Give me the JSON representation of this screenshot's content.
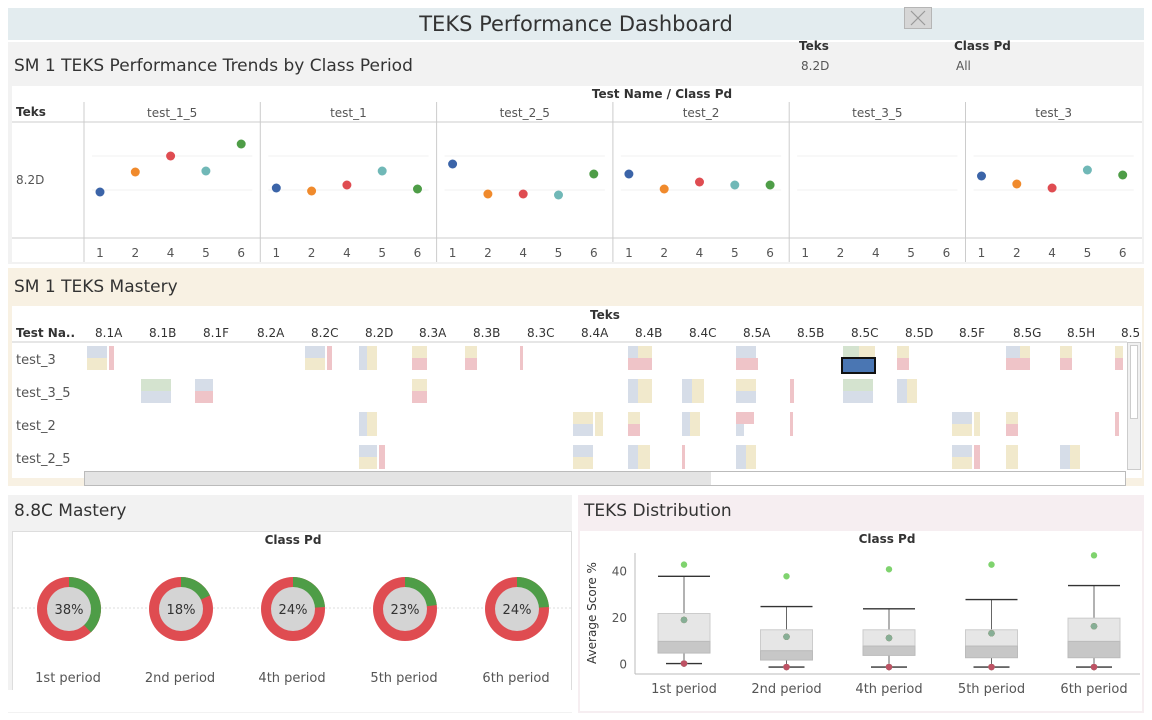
{
  "dashboard_title": "TEKS Performance Dashboard",
  "trend": {
    "title": "SM 1 TEKS Performance Trends by Class Period",
    "filter_teks_label": "Teks",
    "filter_teks_value": "8.2D",
    "filter_classpd_label": "Class Pd",
    "filter_classpd_value": "All",
    "header_label": "Test Name / Class Pd",
    "row_header": "Teks",
    "row_value": "8.2D",
    "panels": [
      "test_1_5",
      "test_1",
      "test_2_5",
      "test_2",
      "test_3_5",
      "test_3"
    ],
    "periods": [
      "1",
      "2",
      "4",
      "5",
      "6"
    ],
    "colors": {
      "1": "#3b64a8",
      "2": "#f08a2c",
      "4": "#df4c51",
      "5": "#70b8b7",
      "6": "#4e9d47"
    },
    "chart_data": {
      "type": "scatter",
      "note_series": "one point per class period within each test panel",
      "panels": [
        {
          "name": "test_1_5",
          "values": [
            0.38,
            0.58,
            0.74,
            0.59,
            0.86
          ]
        },
        {
          "name": "test_1",
          "values": [
            0.42,
            0.39,
            0.45,
            0.59,
            0.41
          ]
        },
        {
          "name": "test_2_5",
          "values": [
            0.66,
            0.36,
            0.36,
            0.35,
            0.56
          ]
        },
        {
          "name": "test_2",
          "values": [
            0.56,
            0.41,
            0.48,
            0.45,
            0.45
          ]
        },
        {
          "name": "test_3_5",
          "values": [
            null,
            null,
            null,
            null,
            null
          ]
        },
        {
          "name": "test_3",
          "values": [
            0.54,
            0.46,
            0.42,
            0.6,
            0.55
          ]
        }
      ]
    }
  },
  "mastery": {
    "title": "SM 1 TEKS Mastery",
    "col_header": "Teks",
    "row_header": "Test Na..",
    "teks": [
      "8.1A",
      "8.1B",
      "8.1F",
      "8.2A",
      "8.2C",
      "8.2D",
      "8.3A",
      "8.3B",
      "8.3C",
      "8.4A",
      "8.4B",
      "8.4C",
      "8.5A",
      "8.5B",
      "8.5C",
      "8.5D",
      "8.5F",
      "8.5G",
      "8.5H",
      "8.5"
    ],
    "tests": [
      "test_3",
      "test_3_5",
      "test_2",
      "test_2_5"
    ]
  },
  "donuts": {
    "title": "8.8C Mastery",
    "header": "Class Pd",
    "colors": {
      "mastered": "#4e9d47",
      "not_mastered": "#df4c51",
      "center": "#d4d4d4"
    },
    "items": [
      {
        "label": "1st period",
        "pct_label": "38%",
        "pct": 0.38
      },
      {
        "label": "2nd period",
        "pct_label": "18%",
        "pct": 0.18
      },
      {
        "label": "4th period",
        "pct_label": "24%",
        "pct": 0.24
      },
      {
        "label": "5th period",
        "pct_label": "23%",
        "pct": 0.23
      },
      {
        "label": "6th period",
        "pct_label": "24%",
        "pct": 0.24
      }
    ]
  },
  "distribution": {
    "title": "TEKS Distribution",
    "chart_data": {
      "type": "box",
      "header": "Class Pd",
      "ylabel": "Average Score %",
      "yticks": [
        0,
        20,
        40
      ],
      "ylim": [
        -4,
        48
      ],
      "categories": [
        "1st period",
        "2nd period",
        "4th period",
        "5th period",
        "6th period"
      ],
      "boxes": [
        {
          "min": 0.5,
          "q1": 5,
          "median": 10,
          "q3": 22,
          "max": 38
        },
        {
          "min": -1,
          "q1": 2,
          "median": 6,
          "q3": 15,
          "max": 25
        },
        {
          "min": -1,
          "q1": 4,
          "median": 8,
          "q3": 15,
          "max": 24
        },
        {
          "min": -1,
          "q1": 3,
          "median": 8,
          "q3": 15,
          "max": 28
        },
        {
          "min": -1,
          "q1": 3,
          "median": 10,
          "q3": 20,
          "max": 34
        }
      ],
      "points_max": [
        43,
        38,
        41,
        43,
        47
      ]
    }
  }
}
